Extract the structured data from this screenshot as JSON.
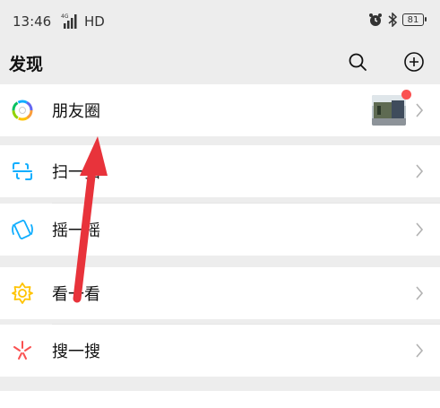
{
  "status_bar": {
    "time": "13:46",
    "network": "4G",
    "hd": "HD",
    "battery": "81",
    "icons": [
      "signal-icon",
      "alarm-icon",
      "bluetooth-icon",
      "battery-icon"
    ]
  },
  "header": {
    "title": "发现",
    "icons": [
      "search-icon",
      "add-icon"
    ]
  },
  "menu": {
    "moments": {
      "label": "朋友圈",
      "icon": "moments-icon",
      "has_new_badge": true
    },
    "scan": {
      "label": "扫一扫",
      "icon": "scan-icon"
    },
    "shake": {
      "label": "摇一摇",
      "icon": "shake-icon"
    },
    "top_stories": {
      "label": "看一看",
      "icon": "top-stories-icon"
    },
    "search": {
      "label": "搜一搜",
      "icon": "search-feature-icon"
    }
  },
  "colors": {
    "background": "#ededed",
    "row": "#ffffff",
    "badge": "#fa5151",
    "annotation_arrow": "#e8333b"
  },
  "annotation": "red-arrow-pointing-to-moments"
}
